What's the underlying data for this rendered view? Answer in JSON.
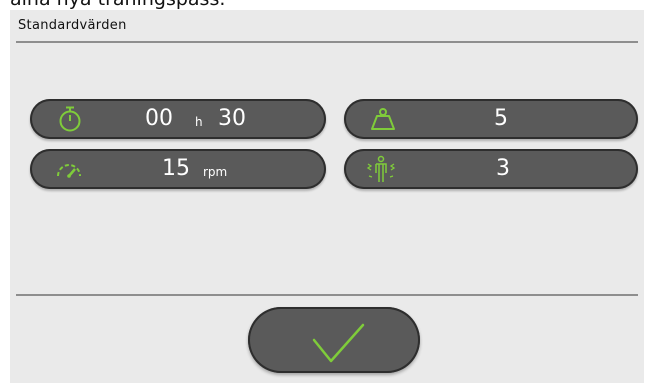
{
  "top_text": "aina nya träningspass.",
  "panel": {
    "title": "Standardvärden"
  },
  "settings": {
    "duration": {
      "hours": "00",
      "hours_unit": "h",
      "minutes": "30",
      "icon": "stopwatch-icon"
    },
    "weight": {
      "value": "5",
      "icon": "weight-icon"
    },
    "speed": {
      "value": "15",
      "unit": "rpm",
      "icon": "speedometer-icon"
    },
    "spasm": {
      "value": "3",
      "icon": "spasm-person-icon"
    }
  },
  "confirm": {
    "icon": "checkmark-icon"
  },
  "colors": {
    "panel_bg": "#eaeaea",
    "pill_bg": "#5a5a5a",
    "accent_green": "#7fcc3a",
    "rule": "#8e8e8e"
  }
}
